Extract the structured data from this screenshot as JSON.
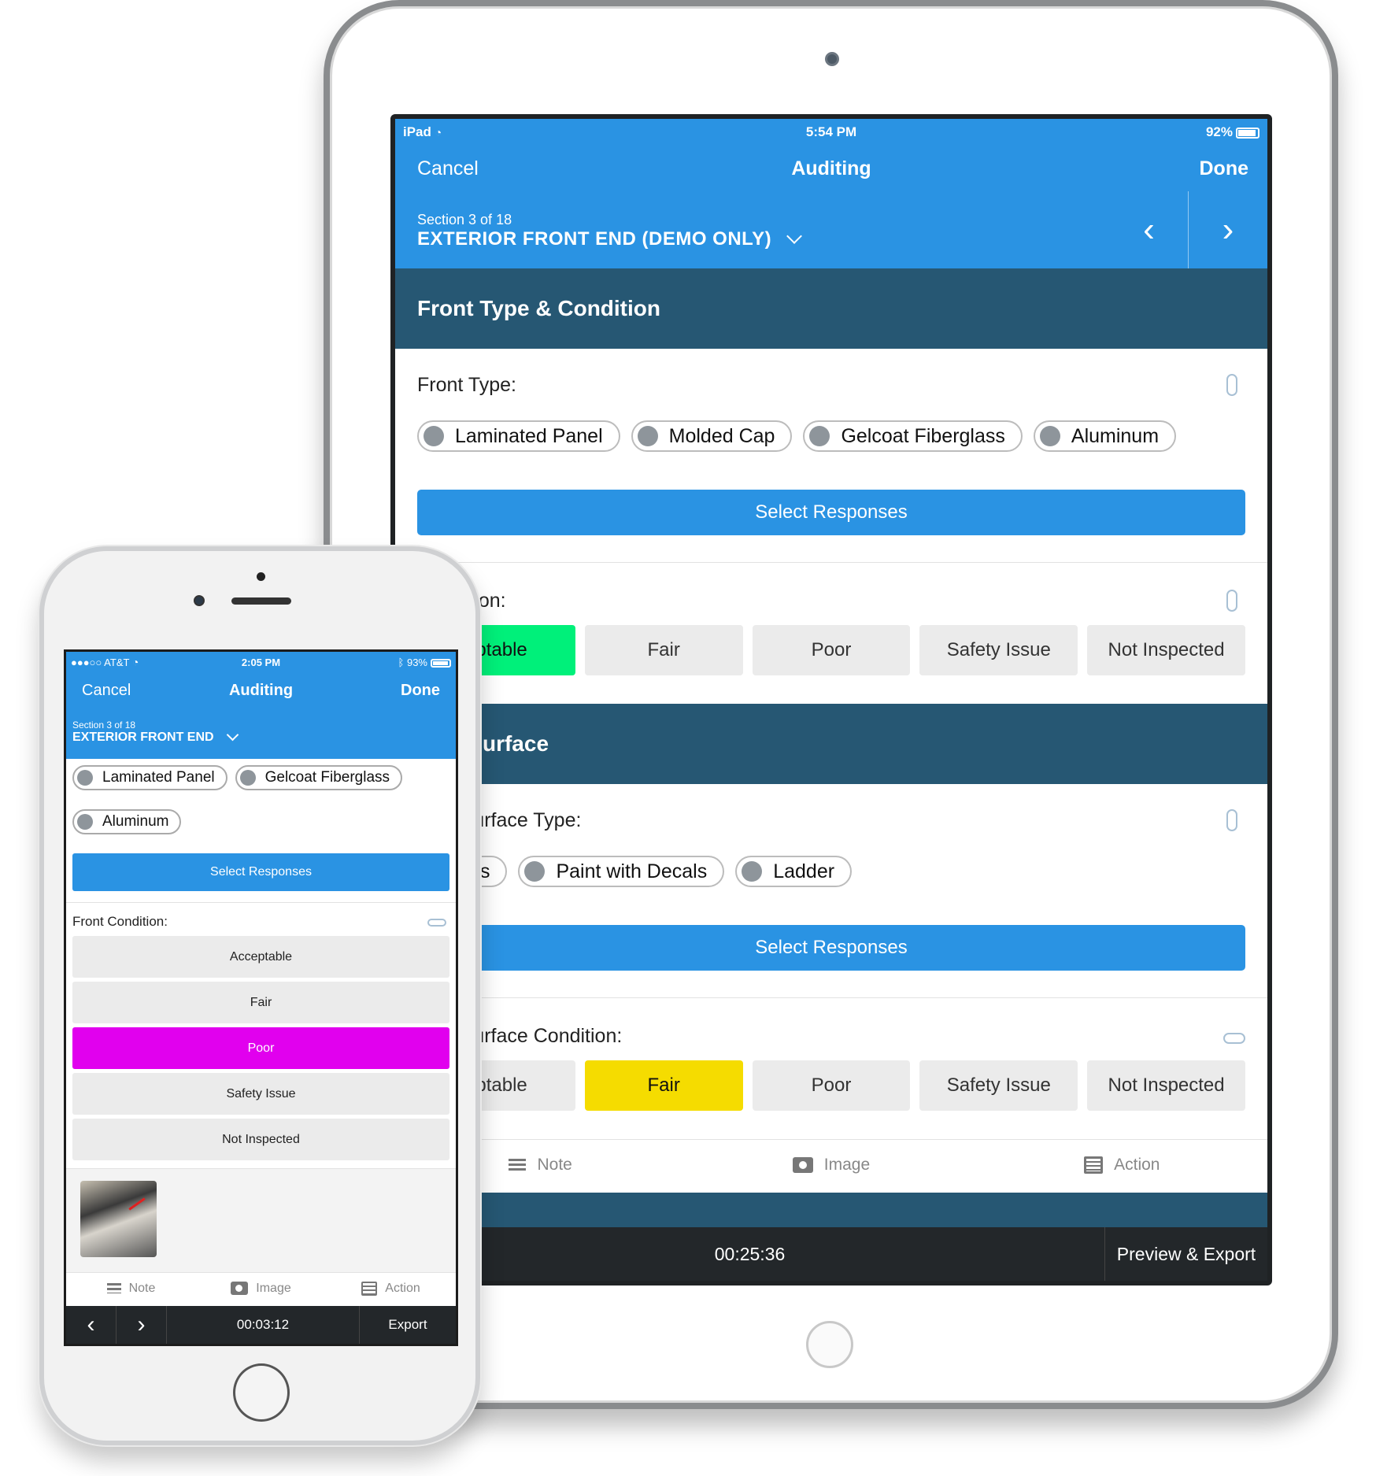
{
  "colors": {
    "brand_blue": "#2a93e3",
    "section_header": "#265773",
    "footer_dark": "#23272a",
    "selected_acceptable": "#00f07a",
    "selected_fair": "#f5dc00",
    "selected_poor": "#e100ee",
    "option_bg": "#ebebeb"
  },
  "ipad": {
    "status": {
      "device": "iPad",
      "time": "5:54 PM",
      "battery": "92%",
      "battery_level": 0.92
    },
    "nav": {
      "cancel": "Cancel",
      "title": "Auditing",
      "done": "Done"
    },
    "section": {
      "counter": "Section 3 of 18",
      "name": "EXTERIOR FRONT END (DEMO ONLY)"
    },
    "groups": [
      {
        "title": "Front Type & Condition",
        "questions": [
          {
            "label": "Front Type:",
            "options": [
              "Laminated Panel",
              "Molded Cap",
              "Gelcoat Fiberglass",
              "Aluminum"
            ],
            "button": "Select Responses"
          },
          {
            "label": "Condition:",
            "options": [
              "eptable",
              "Fair",
              "Poor",
              "Safety Issue",
              "Not Inspected"
            ],
            "selected": "eptable"
          }
        ]
      },
      {
        "title": "Wall Surface",
        "questions": [
          {
            "label": "Wall Surface Type:",
            "options": [
              "cals",
              "Paint with Decals",
              "Ladder"
            ],
            "button": "Select Responses"
          },
          {
            "label": "Wall Surface Condition:",
            "options": [
              "eptable",
              "Fair",
              "Poor",
              "Safety Issue",
              "Not Inspected"
            ],
            "selected": "Fair"
          }
        ]
      }
    ],
    "actions": {
      "note": "Note",
      "image": "Image",
      "action": "Action"
    },
    "footer": {
      "timer": "00:25:36",
      "export": "Preview & Export"
    }
  },
  "iphone": {
    "status": {
      "carrier": "AT&T",
      "signal": "●●●○○",
      "time": "2:05 PM",
      "battery": "93%",
      "battery_level": 0.93
    },
    "nav": {
      "cancel": "Cancel",
      "title": "Auditing",
      "done": "Done"
    },
    "section": {
      "counter": "Section 3 of 18",
      "name": "EXTERIOR FRONT END"
    },
    "front_type_options": [
      "Laminated Panel",
      "Gelcoat Fiberglass",
      "Aluminum"
    ],
    "select_button": "Select Responses",
    "condition": {
      "label": "Front Condition:",
      "options": [
        "Acceptable",
        "Fair",
        "Poor",
        "Safety Issue",
        "Not Inspected"
      ],
      "selected": "Poor"
    },
    "actions": {
      "note": "Note",
      "image": "Image",
      "action": "Action"
    },
    "footer": {
      "timer": "00:03:12",
      "export": "Export",
      "prev": "‹",
      "next": "›"
    }
  }
}
